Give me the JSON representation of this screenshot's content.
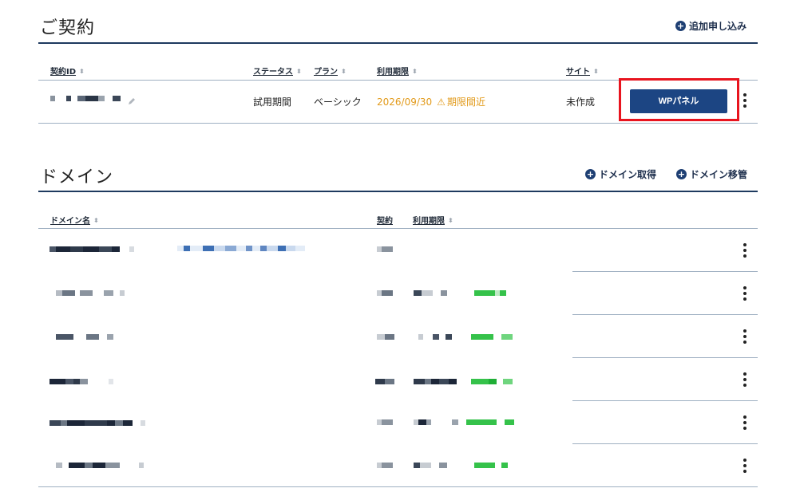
{
  "contract": {
    "title": "ご契約",
    "add_action": "追加申し込み",
    "columns": {
      "id": "契約ID",
      "status": "ステータス",
      "plan": "プラン",
      "expiry": "利用期限",
      "site": "サイト"
    },
    "row": {
      "status": "試用期間",
      "plan": "ベーシック",
      "expiry_date": "2026/09/30",
      "expiry_warning": "期限間近",
      "site": "未作成",
      "wp_button": "WPパネル"
    },
    "colors": {
      "accent": "#1c4583",
      "warning": "#e29a1a",
      "highlight": "#e8141e"
    }
  },
  "domain": {
    "title": "ドメイン",
    "actions": {
      "acquire": "ドメイン取得",
      "transfer": "ドメイン移管"
    },
    "columns": {
      "name": "ドメイン名",
      "contract": "契約",
      "expiry": "利用期限"
    },
    "row_count": 6
  }
}
